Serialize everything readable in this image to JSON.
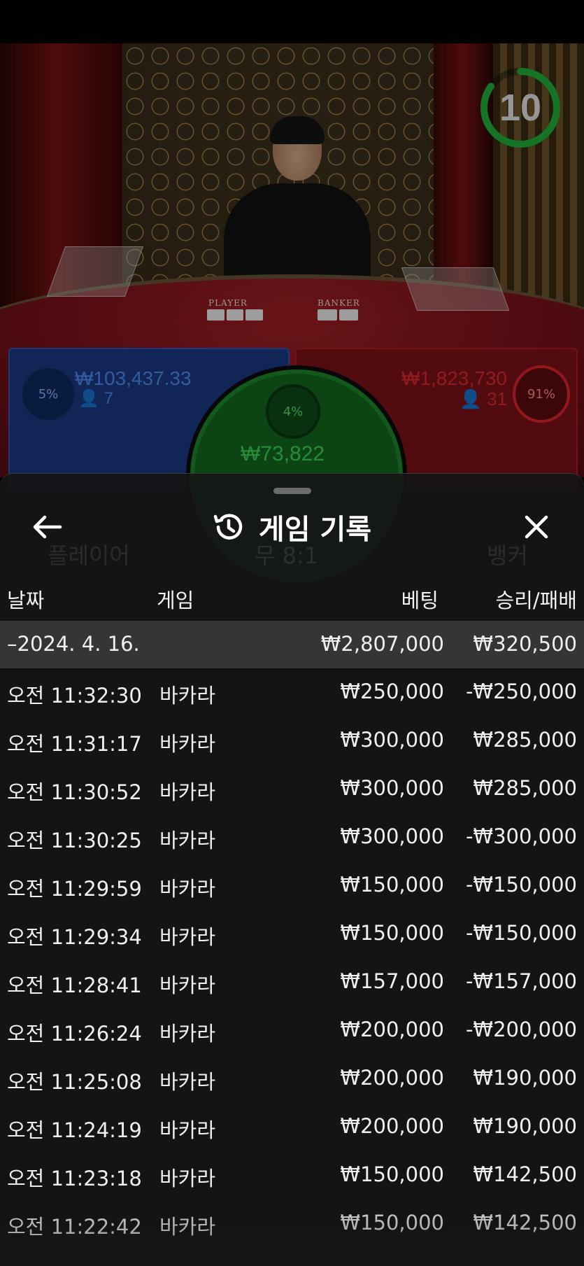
{
  "live": {
    "timer": "10",
    "timer_progress": 0.85,
    "table_labels": {
      "player": "PLAYER",
      "banker": "BANKER"
    },
    "player": {
      "percent": "5%",
      "amount": "₩103,437.33",
      "count": "7"
    },
    "banker": {
      "percent": "91%",
      "amount": "₩1,823,730",
      "count": "31"
    },
    "tie": {
      "percent": "4%",
      "amount": "₩73,822"
    }
  },
  "colors": {
    "player": "#1c3a86",
    "banker": "#7e1218",
    "tie": "#13691f",
    "timer_ring": "#22b33c"
  },
  "background": {
    "player_label": "플레이어",
    "tie_label": "무 8:1",
    "banker_label": "뱅커"
  },
  "history": {
    "title": "게임 기록",
    "back_icon": "arrow-left-icon",
    "history_icon": "history-icon",
    "close_icon": "close-icon",
    "columns": {
      "date": "날짜",
      "game": "게임",
      "bet": "베팅",
      "result": "승리/패배"
    },
    "summary": {
      "date": "–2024. 4. 16.",
      "bet": "₩2,807,000",
      "result": "₩320,500"
    },
    "rows": [
      {
        "time": "오전 11:32:30",
        "game": "바카라",
        "bet": "₩250,000",
        "result": "-₩250,000"
      },
      {
        "time": "오전 11:31:17",
        "game": "바카라",
        "bet": "₩300,000",
        "result": "₩285,000"
      },
      {
        "time": "오전 11:30:52",
        "game": "바카라",
        "bet": "₩300,000",
        "result": "₩285,000"
      },
      {
        "time": "오전 11:30:25",
        "game": "바카라",
        "bet": "₩300,000",
        "result": "-₩300,000"
      },
      {
        "time": "오전 11:29:59",
        "game": "바카라",
        "bet": "₩150,000",
        "result": "-₩150,000"
      },
      {
        "time": "오전 11:29:34",
        "game": "바카라",
        "bet": "₩150,000",
        "result": "-₩150,000"
      },
      {
        "time": "오전 11:28:41",
        "game": "바카라",
        "bet": "₩157,000",
        "result": "-₩157,000"
      },
      {
        "time": "오전 11:26:24",
        "game": "바카라",
        "bet": "₩200,000",
        "result": "-₩200,000"
      },
      {
        "time": "오전 11:25:08",
        "game": "바카라",
        "bet": "₩200,000",
        "result": "₩190,000"
      },
      {
        "time": "오전 11:24:19",
        "game": "바카라",
        "bet": "₩200,000",
        "result": "₩190,000"
      },
      {
        "time": "오전 11:23:18",
        "game": "바카라",
        "bet": "₩150,000",
        "result": "₩142,500"
      },
      {
        "time": "오전 11:22:42",
        "game": "바카라",
        "bet": "₩150,000",
        "result": "₩142,500"
      }
    ]
  }
}
